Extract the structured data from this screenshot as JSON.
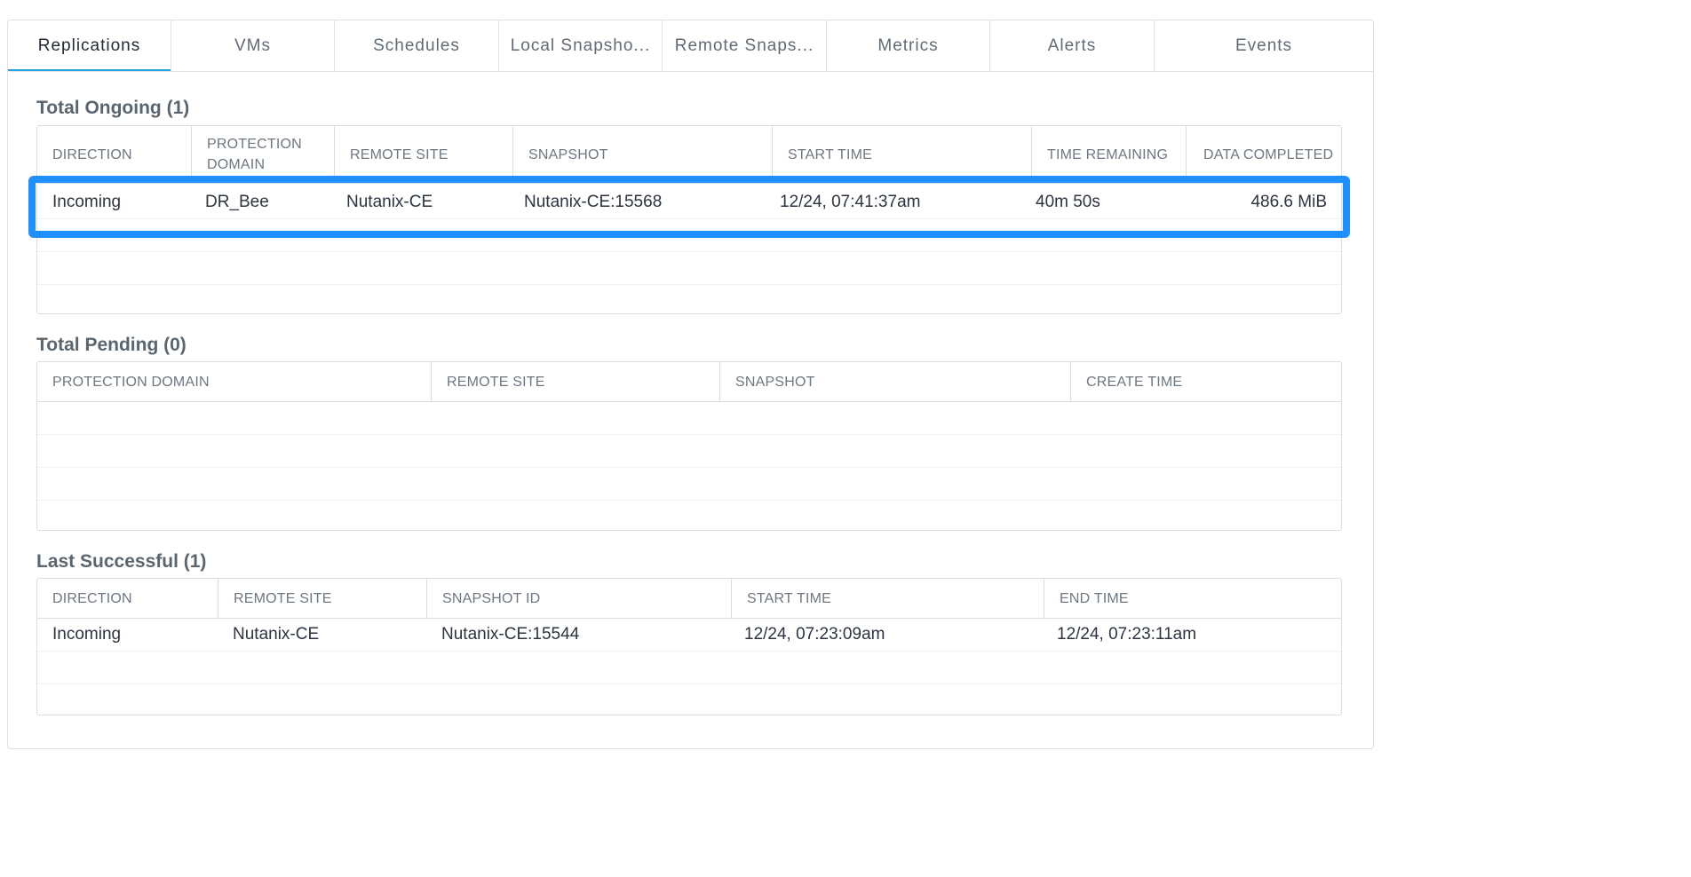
{
  "tabs": [
    {
      "label": "Replications",
      "active": true
    },
    {
      "label": "VMs"
    },
    {
      "label": "Schedules"
    },
    {
      "label": "Local Snapsho..."
    },
    {
      "label": "Remote Snaps..."
    },
    {
      "label": "Metrics"
    },
    {
      "label": "Alerts"
    },
    {
      "label": "Events"
    }
  ],
  "ongoing": {
    "title": "Total Ongoing (1)",
    "headers": [
      "DIRECTION",
      "PROTECTION DOMAIN",
      "REMOTE SITE",
      "SNAPSHOT",
      "START TIME",
      "TIME REMAINING",
      "DATA COMPLETED"
    ],
    "rows": [
      [
        "Incoming",
        "DR_Bee",
        "Nutanix-CE",
        "Nutanix-CE:15568",
        "12/24, 07:41:37am",
        "40m 50s",
        "486.6 MiB"
      ]
    ]
  },
  "pending": {
    "title": "Total Pending (0)",
    "headers": [
      "PROTECTION DOMAIN",
      "REMOTE SITE",
      "SNAPSHOT",
      "CREATE TIME"
    ],
    "rows": []
  },
  "successful": {
    "title": "Last Successful (1)",
    "headers": [
      "DIRECTION",
      "REMOTE SITE",
      "SNAPSHOT ID",
      "START TIME",
      "END TIME"
    ],
    "rows": [
      [
        "Incoming",
        "Nutanix-CE",
        "Nutanix-CE:15544",
        "12/24, 07:23:09am",
        "12/24, 07:23:11am"
      ]
    ]
  },
  "highlight_color": "#1e90ff",
  "accent_color": "#21a7e6"
}
